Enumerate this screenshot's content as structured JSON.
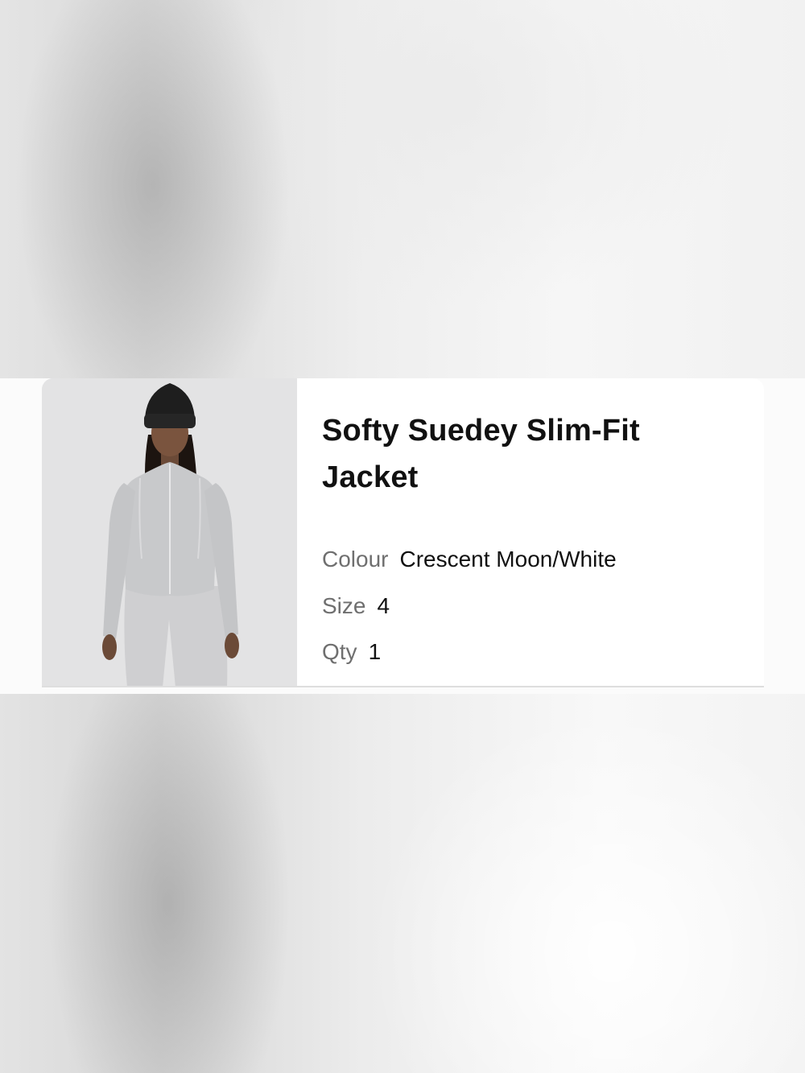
{
  "product": {
    "name": "Softy Suedey Slim-Fit Jacket",
    "image_alt": "Model wearing grey slim-fit jacket with black beanie",
    "attributes": {
      "colour_label": "Colour",
      "colour_value": "Crescent Moon/White",
      "size_label": "Size",
      "size_value": "4",
      "qty_label": "Qty",
      "qty_value": "1"
    }
  },
  "colors": {
    "card_background": "#ffffff",
    "image_background": "#e3e3e4",
    "label_text": "#6f6f6f",
    "value_text": "#111111"
  }
}
